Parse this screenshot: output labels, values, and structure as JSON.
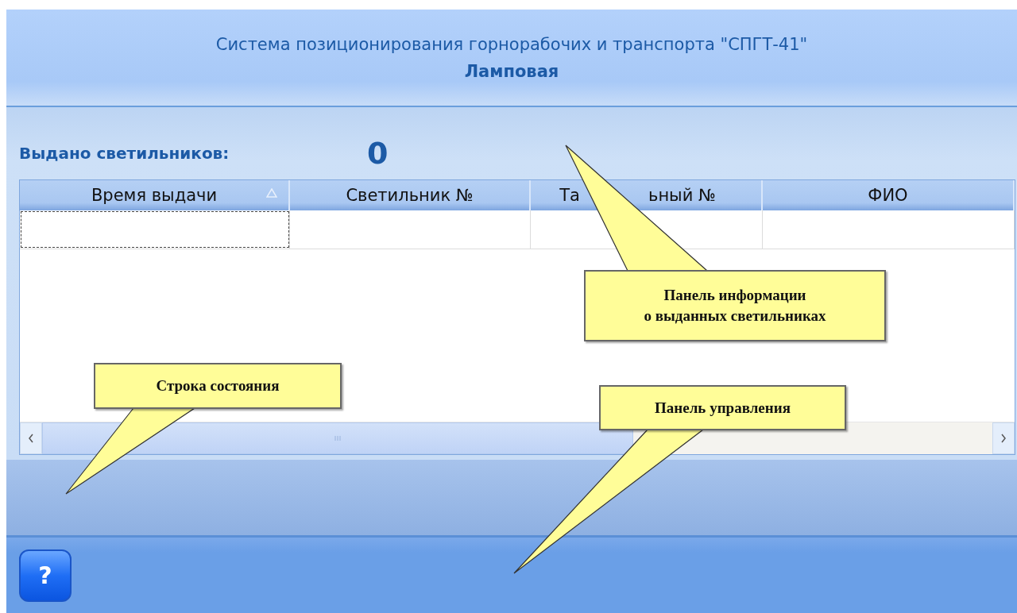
{
  "header": {
    "title": "Система позиционирования горнорабочих и транспорта \"СПГТ-41\"",
    "subtitle": "Ламповая"
  },
  "counter": {
    "label": "Выдано светильников:",
    "value": "0"
  },
  "table": {
    "columns": [
      {
        "kind": "text",
        "label": "Время выдачи",
        "sorted": true
      },
      {
        "kind": "text",
        "label": "Светильник №",
        "sorted": false
      },
      {
        "kind": "covered",
        "label_parts": [
          "Та",
          "ьный №"
        ],
        "sorted": false
      },
      {
        "kind": "text",
        "label": "ФИО",
        "sorted": false
      }
    ]
  },
  "toolbar": {
    "help_button": "?"
  },
  "callouts": [
    {
      "lines": [
        "Панель информации",
        "о выданных светильниках"
      ]
    },
    {
      "lines": [
        "Строка состояния"
      ]
    },
    {
      "lines": [
        "Панель управления"
      ]
    }
  ]
}
